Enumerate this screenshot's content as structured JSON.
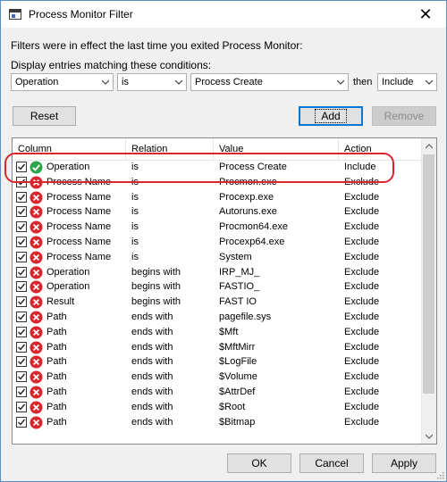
{
  "window": {
    "title": "Process Monitor Filter",
    "icon": "window-app-icon",
    "close_glyph": "✕"
  },
  "intro": "Filters were in effect the last time you exited Process Monitor:",
  "conditions_label": "Display entries matching these conditions:",
  "editor": {
    "column_value": "Operation",
    "relation_value": "is",
    "value_text": "Process Create",
    "then_label": "then",
    "action_value": "Include"
  },
  "buttons": {
    "reset": "Reset",
    "add": "Add",
    "remove": "Remove",
    "ok": "OK",
    "cancel": "Cancel",
    "apply": "Apply"
  },
  "table": {
    "headers": [
      "Column",
      "Relation",
      "Value",
      "Action"
    ],
    "rows": [
      {
        "checked": true,
        "status": "include",
        "column": "Operation",
        "relation": "is",
        "value": "Process Create",
        "action": "Include"
      },
      {
        "checked": true,
        "status": "exclude",
        "column": "Process Name",
        "relation": "is",
        "value": "Procmon.exe",
        "action": "Exclude"
      },
      {
        "checked": true,
        "status": "exclude",
        "column": "Process Name",
        "relation": "is",
        "value": "Procexp.exe",
        "action": "Exclude"
      },
      {
        "checked": true,
        "status": "exclude",
        "column": "Process Name",
        "relation": "is",
        "value": "Autoruns.exe",
        "action": "Exclude"
      },
      {
        "checked": true,
        "status": "exclude",
        "column": "Process Name",
        "relation": "is",
        "value": "Procmon64.exe",
        "action": "Exclude"
      },
      {
        "checked": true,
        "status": "exclude",
        "column": "Process Name",
        "relation": "is",
        "value": "Procexp64.exe",
        "action": "Exclude"
      },
      {
        "checked": true,
        "status": "exclude",
        "column": "Process Name",
        "relation": "is",
        "value": "System",
        "action": "Exclude"
      },
      {
        "checked": true,
        "status": "exclude",
        "column": "Operation",
        "relation": "begins with",
        "value": "IRP_MJ_",
        "action": "Exclude"
      },
      {
        "checked": true,
        "status": "exclude",
        "column": "Operation",
        "relation": "begins with",
        "value": "FASTIO_",
        "action": "Exclude"
      },
      {
        "checked": true,
        "status": "exclude",
        "column": "Result",
        "relation": "begins with",
        "value": "FAST IO",
        "action": "Exclude"
      },
      {
        "checked": true,
        "status": "exclude",
        "column": "Path",
        "relation": "ends with",
        "value": "pagefile.sys",
        "action": "Exclude"
      },
      {
        "checked": true,
        "status": "exclude",
        "column": "Path",
        "relation": "ends with",
        "value": "$Mft",
        "action": "Exclude"
      },
      {
        "checked": true,
        "status": "exclude",
        "column": "Path",
        "relation": "ends with",
        "value": "$MftMirr",
        "action": "Exclude"
      },
      {
        "checked": true,
        "status": "exclude",
        "column": "Path",
        "relation": "ends with",
        "value": "$LogFile",
        "action": "Exclude"
      },
      {
        "checked": true,
        "status": "exclude",
        "column": "Path",
        "relation": "ends with",
        "value": "$Volume",
        "action": "Exclude"
      },
      {
        "checked": true,
        "status": "exclude",
        "column": "Path",
        "relation": "ends with",
        "value": "$AttrDef",
        "action": "Exclude"
      },
      {
        "checked": true,
        "status": "exclude",
        "column": "Path",
        "relation": "ends with",
        "value": "$Root",
        "action": "Exclude"
      },
      {
        "checked": true,
        "status": "exclude",
        "column": "Path",
        "relation": "ends with",
        "value": "$Bitmap",
        "action": "Exclude"
      }
    ]
  },
  "colors": {
    "include": "#2da44e",
    "exclude": "#d7262e",
    "highlight": "#d9262c",
    "accent": "#0078d7"
  }
}
